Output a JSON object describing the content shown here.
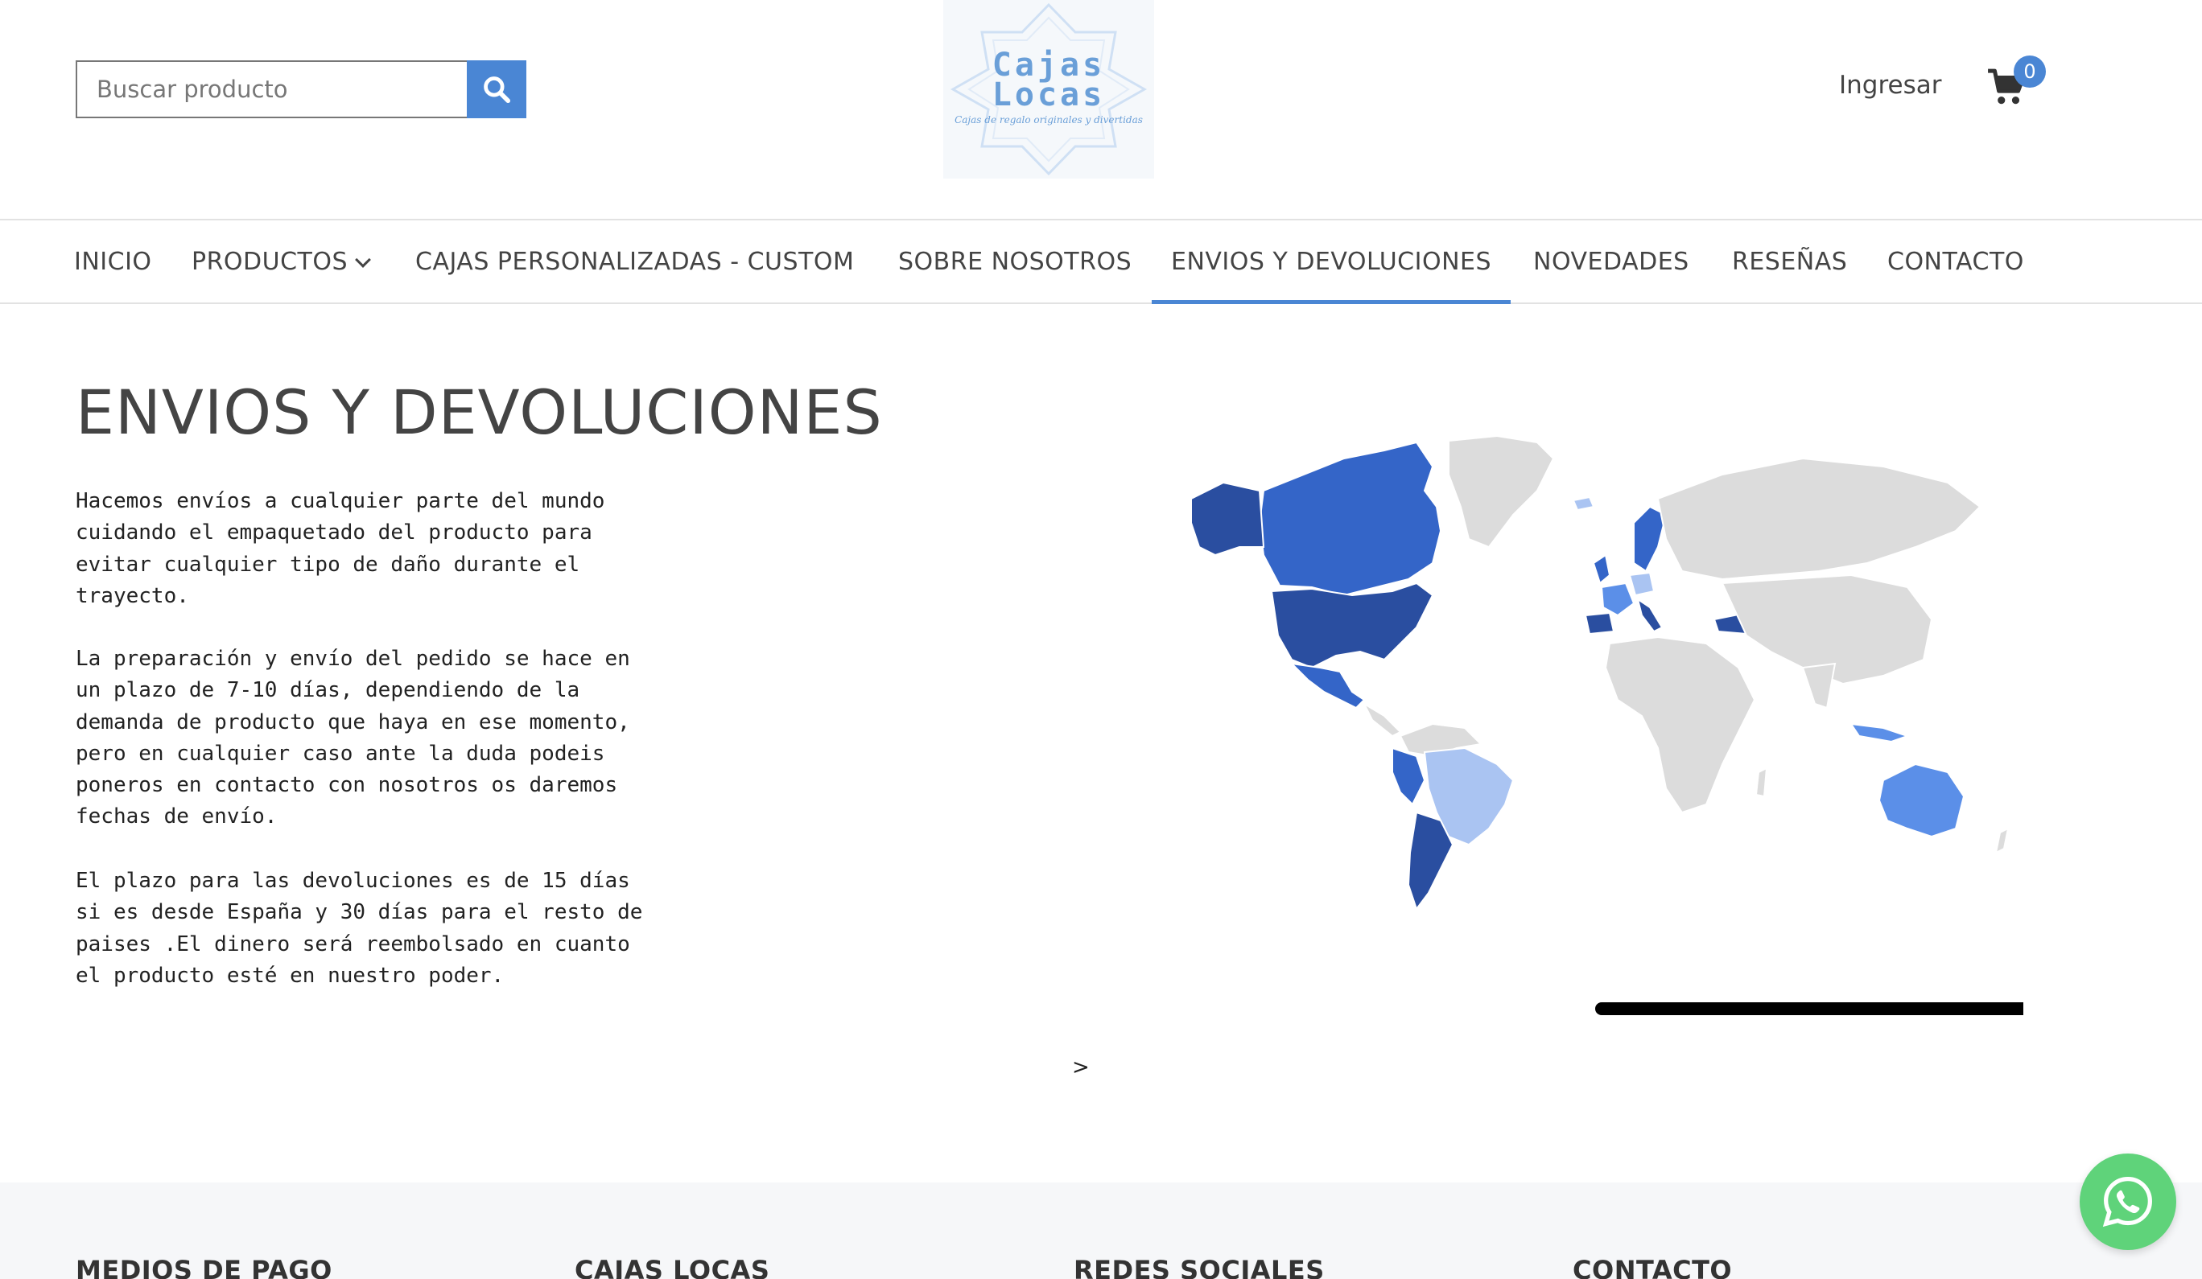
{
  "header": {
    "search_placeholder": "Buscar producto",
    "logo_title_line1": "Cajas",
    "logo_title_line2": "Locas",
    "logo_tagline": "Cajas de regalo originales y divertidas",
    "login_label": "Ingresar",
    "cart_count": "0"
  },
  "nav": {
    "items": [
      {
        "label": "INICIO"
      },
      {
        "label": "PRODUCTOS"
      },
      {
        "label": "CAJAS PERSONALIZADAS - CUSTOM"
      },
      {
        "label": "SOBRE NOSOTROS"
      },
      {
        "label": "ENVIOS Y DEVOLUCIONES"
      },
      {
        "label": "NOVEDADES"
      },
      {
        "label": "RESEÑAS"
      },
      {
        "label": "CONTACTO"
      }
    ],
    "active_index": 4
  },
  "main": {
    "title": "ENVIOS Y DEVOLUCIONES",
    "paragraph1": "Hacemos envíos a cualquier parte del mundo cuidando el empaquetado del producto para evitar cualquier tipo de daño durante el trayecto.",
    "paragraph2": "La preparación y envío del pedido se hace en un plazo de 7-10 días, dependiendo de la demanda de producto que haya en ese momento, pero en cualquier caso ante la duda podeis poneros en contacto con nosotros os daremos fechas de envío.",
    "paragraph3": "El plazo para las devoluciones es de 15 días si es desde España y 30 días para el resto de paises .El dinero será reembolsado en cuanto el producto esté en nuestro poder.",
    "next_arrow": ">"
  },
  "footer": {
    "headings": [
      "MEDIOS DE PAGO",
      "CAJAS LOCAS",
      "REDES SOCIALES",
      "CONTACTO"
    ]
  },
  "colors": {
    "accent": "#4a86d4",
    "map_dark": "#2a4ea0",
    "map_mid": "#3465c8",
    "map_light": "#5b8fe8",
    "map_pale": "#aac4f2",
    "map_gray": "#dcdcdc",
    "whatsapp": "#5fd37a"
  }
}
